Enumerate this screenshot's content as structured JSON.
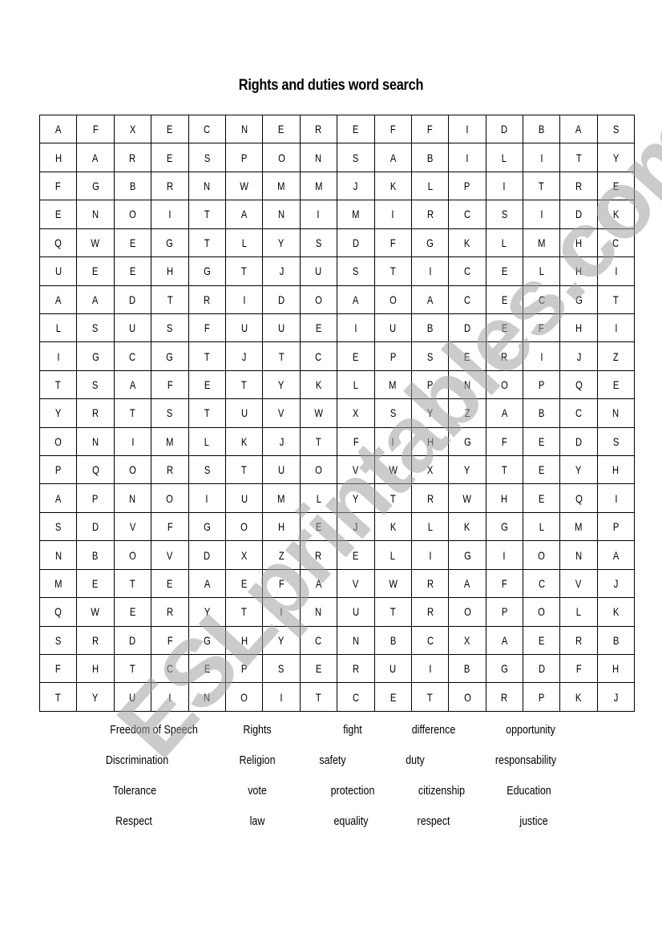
{
  "title": "Rights and duties word search",
  "grid": [
    [
      "A",
      "F",
      "X",
      "E",
      "C",
      "N",
      "E",
      "R",
      "E",
      "F",
      "F",
      "I",
      "D",
      "B",
      "A",
      "S"
    ],
    [
      "H",
      "A",
      "R",
      "E",
      "S",
      "P",
      "O",
      "N",
      "S",
      "A",
      "B",
      "I",
      "L",
      "I",
      "T",
      "Y"
    ],
    [
      "F",
      "G",
      "B",
      "R",
      "N",
      "W",
      "M",
      "M",
      "J",
      "K",
      "L",
      "P",
      "I",
      "T",
      "R",
      "E"
    ],
    [
      "E",
      "N",
      "O",
      "I",
      "T",
      "A",
      "N",
      "I",
      "M",
      "I",
      "R",
      "C",
      "S",
      "I",
      "D",
      "K"
    ],
    [
      "Q",
      "W",
      "E",
      "G",
      "T",
      "L",
      "Y",
      "S",
      "D",
      "F",
      "G",
      "K",
      "L",
      "M",
      "H",
      "C"
    ],
    [
      "U",
      "E",
      "E",
      "H",
      "G",
      "T",
      "J",
      "U",
      "S",
      "T",
      "I",
      "C",
      "E",
      "L",
      "H",
      "I"
    ],
    [
      "A",
      "A",
      "D",
      "T",
      "R",
      "I",
      "D",
      "O",
      "A",
      "O",
      "A",
      "C",
      "E",
      "C",
      "G",
      "T"
    ],
    [
      "L",
      "S",
      "U",
      "S",
      "F",
      "U",
      "U",
      "E",
      "I",
      "U",
      "B",
      "D",
      "E",
      "F",
      "H",
      "I"
    ],
    [
      "I",
      "G",
      "C",
      "G",
      "T",
      "J",
      "T",
      "C",
      "E",
      "P",
      "S",
      "E",
      "R",
      "I",
      "J",
      "Z"
    ],
    [
      "T",
      "S",
      "A",
      "F",
      "E",
      "T",
      "Y",
      "K",
      "L",
      "M",
      "P",
      "N",
      "O",
      "P",
      "Q",
      "E"
    ],
    [
      "Y",
      "R",
      "T",
      "S",
      "T",
      "U",
      "V",
      "W",
      "X",
      "S",
      "Y",
      "Z",
      "A",
      "B",
      "C",
      "N"
    ],
    [
      "O",
      "N",
      "I",
      "M",
      "L",
      "K",
      "J",
      "T",
      "F",
      "I",
      "H",
      "G",
      "F",
      "E",
      "D",
      "S"
    ],
    [
      "P",
      "Q",
      "O",
      "R",
      "S",
      "T",
      "U",
      "O",
      "V",
      "W",
      "X",
      "Y",
      "T",
      "E",
      "Y",
      "H"
    ],
    [
      "A",
      "P",
      "N",
      "O",
      "I",
      "U",
      "M",
      "L",
      "Y",
      "T",
      "R",
      "W",
      "H",
      "E",
      "Q",
      "I"
    ],
    [
      "S",
      "D",
      "V",
      "F",
      "G",
      "O",
      "H",
      "E",
      "J",
      "K",
      "L",
      "K",
      "G",
      "L",
      "M",
      "P"
    ],
    [
      "N",
      "B",
      "O",
      "V",
      "D",
      "X",
      "Z",
      "R",
      "E",
      "L",
      "I",
      "G",
      "I",
      "O",
      "N",
      "A"
    ],
    [
      "M",
      "E",
      "T",
      "E",
      "A",
      "E",
      "F",
      "A",
      "V",
      "W",
      "R",
      "A",
      "F",
      "C",
      "V",
      "J"
    ],
    [
      "Q",
      "W",
      "E",
      "R",
      "Y",
      "T",
      "I",
      "N",
      "U",
      "T",
      "R",
      "O",
      "P",
      "O",
      "L",
      "K"
    ],
    [
      "S",
      "R",
      "D",
      "F",
      "G",
      "H",
      "Y",
      "C",
      "N",
      "B",
      "C",
      "X",
      "A",
      "E",
      "R",
      "B"
    ],
    [
      "F",
      "H",
      "T",
      "C",
      "E",
      "P",
      "S",
      "E",
      "R",
      "U",
      "I",
      "B",
      "G",
      "D",
      "F",
      "H"
    ],
    [
      "T",
      "Y",
      "U",
      "I",
      "N",
      "O",
      "I",
      "T",
      "C",
      "E",
      "T",
      "O",
      "R",
      "P",
      "K",
      "J"
    ]
  ],
  "word_list": [
    [
      "Freedom of Speech",
      "Rights",
      "fight",
      "difference",
      "opportunity"
    ],
    [
      "Discrimination",
      "Religion",
      "safety",
      "duty",
      "responsability"
    ],
    [
      "Tolerance",
      "vote",
      "protection",
      "citizenship",
      "Education"
    ],
    [
      "Respect",
      "law",
      "equality",
      "respect",
      "justice"
    ]
  ],
  "watermark": "ESLprintables.com"
}
